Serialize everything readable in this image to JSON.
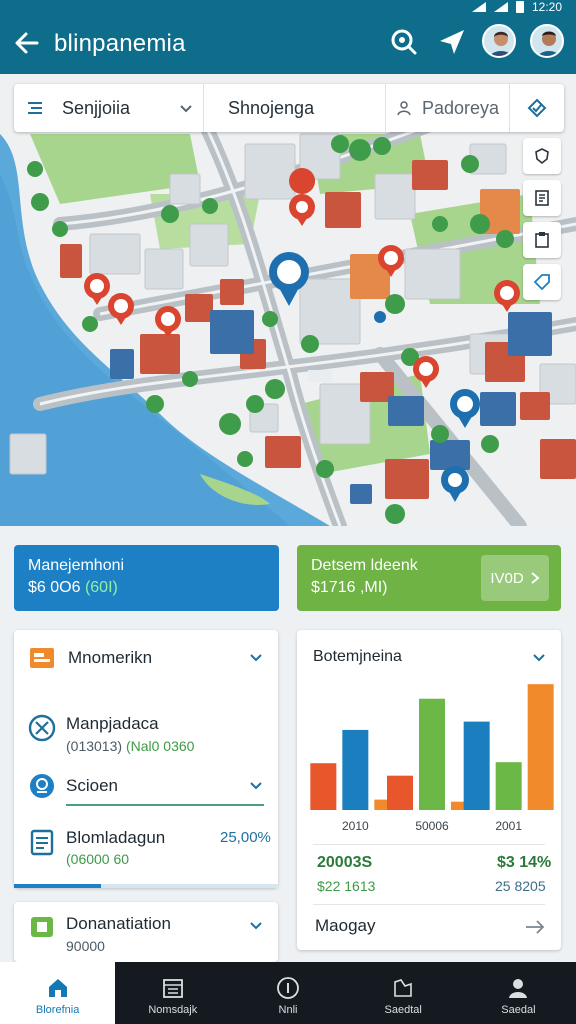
{
  "app": {
    "title": "blinpanemia",
    "status_time": "12:20"
  },
  "search": {
    "location_value": "Senjjoiia",
    "query_value": "Shnojenga",
    "people_placeholder": "Padoreya"
  },
  "summary": {
    "left": {
      "title": "Manejemhoni",
      "value": "$6 0O6 ",
      "value_highlight": "(60I)",
      "color": "#1e80c4"
    },
    "right": {
      "title": "Detsem ldeenk",
      "value": "$1716 ,MI)",
      "button_label": "IV0D",
      "color": "#6eb344"
    }
  },
  "left_card": {
    "header_title": "Mnomerikn",
    "item1_title": "Manpjadaca",
    "item1_sub_a": "(013013) ",
    "item1_sub_b": "(Nal0 0360",
    "item2_title": "Scioen",
    "item3_title": "Blomladagun",
    "item3_value": "25,00%",
    "item3_sub": "(06000 60"
  },
  "bottom_card": {
    "title": "Donanatiation",
    "value": "90000"
  },
  "chart_card": {
    "title": "Botemjneina",
    "stat_left_value": "20003S",
    "stat_left_sub": "$22 1613",
    "stat_right_value": "$3 14%",
    "stat_right_sub": "25 8205",
    "footer_label": "Maogay"
  },
  "chart_data": {
    "type": "bar",
    "categories": [
      "2010",
      "50006",
      "2001"
    ],
    "series": [
      {
        "name": "red",
        "values": [
          0.45,
          0.33,
          0
        ]
      },
      {
        "name": "blue",
        "values": [
          0.77,
          0,
          0.85
        ]
      },
      {
        "name": "green",
        "values": [
          0,
          1.07,
          0.46
        ]
      },
      {
        "name": "orange",
        "values": [
          0.1,
          0.08,
          1.21
        ]
      }
    ],
    "colors": [
      "#e8562b",
      "#1b7fbf",
      "#6cb847",
      "#f08a2a"
    ],
    "ylim": [
      0,
      1.25
    ],
    "grid": false
  },
  "nav": {
    "items": [
      "Blorefnia",
      "Nomsdajk",
      "Nnli",
      "Saedtal",
      "Saedal"
    ]
  },
  "colors": {
    "appbar": "#0f6d8c",
    "water": "#57a8d8",
    "park": "#a7d58d",
    "pin_red": "#d9452e",
    "pin_blue": "#1d6fb0"
  }
}
